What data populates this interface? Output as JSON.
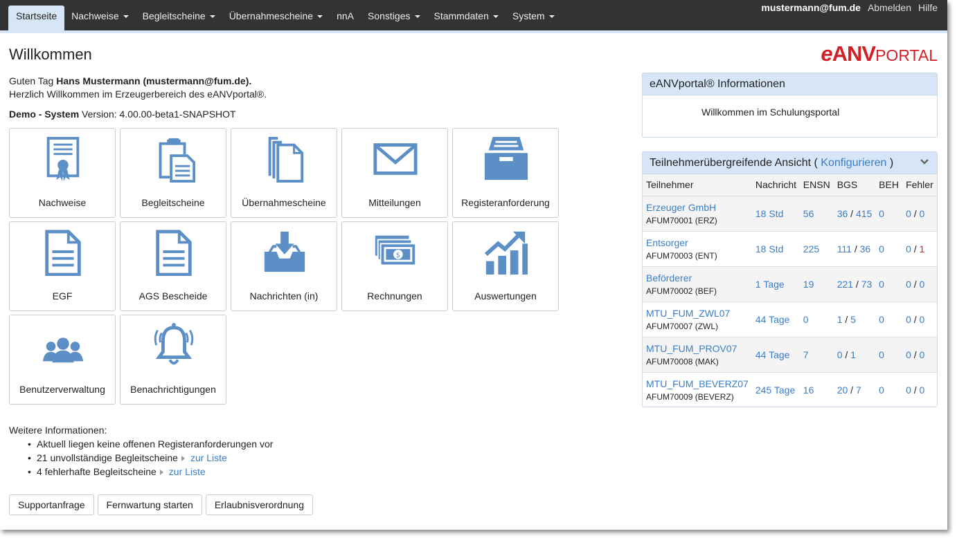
{
  "nav": {
    "items": [
      {
        "label": "Startseite",
        "active": true,
        "dropdown": false
      },
      {
        "label": "Nachweise",
        "active": false,
        "dropdown": true
      },
      {
        "label": "Begleitscheine",
        "active": false,
        "dropdown": true
      },
      {
        "label": "Übernahmescheine",
        "active": false,
        "dropdown": true
      },
      {
        "label": "nnA",
        "active": false,
        "dropdown": false
      },
      {
        "label": "Sonstiges",
        "active": false,
        "dropdown": true
      },
      {
        "label": "Stammdaten",
        "active": false,
        "dropdown": true
      },
      {
        "label": "System",
        "active": false,
        "dropdown": true
      }
    ],
    "user": "mustermann@fum.de",
    "logout": "Abmelden",
    "help": "Hilfe"
  },
  "header": {
    "title": "Willkommen",
    "logo_e": "e",
    "logo_anv": "ANV",
    "logo_portal": "PORTAL"
  },
  "greeting": {
    "prefix": "Guten Tag",
    "name": "Hans Mustermann (mustermann@fum.de).",
    "welcome": "Herzlich Willkommen im Erzeugerbereich des eANVportal®.",
    "system": "Demo - System",
    "version": "Version: 4.00.00-beta1-SNAPSHOT"
  },
  "tiles": [
    {
      "label": "Nachweise",
      "icon": "certificate-icon"
    },
    {
      "label": "Begleitscheine",
      "icon": "clipboard-icon"
    },
    {
      "label": "Übernahmescheine",
      "icon": "documents-stack-icon"
    },
    {
      "label": "Mitteilungen",
      "icon": "envelope-icon"
    },
    {
      "label": "Registeranforderung",
      "icon": "archive-icon"
    },
    {
      "label": "EGF",
      "icon": "document-icon"
    },
    {
      "label": "AGS Bescheide",
      "icon": "document-icon"
    },
    {
      "label": "Nachrichten (in)",
      "icon": "inbox-download-icon"
    },
    {
      "label": "Rechnungen",
      "icon": "money-icon"
    },
    {
      "label": "Auswertungen",
      "icon": "chart-up-icon"
    },
    {
      "label": "Benutzerverwaltung",
      "icon": "users-icon"
    },
    {
      "label": "Benachrichtigungen",
      "icon": "bell-icon"
    }
  ],
  "more_info": {
    "heading": "Weitere Informationen:",
    "items": [
      {
        "text": "Aktuell liegen keine offenen Registeranforderungen vor",
        "link": ""
      },
      {
        "text": "21 unvollständige Begleitscheine",
        "link": "zur Liste"
      },
      {
        "text": "4 fehlerhafte Begleitscheine",
        "link": "zur Liste"
      }
    ]
  },
  "buttons": [
    "Supportanfrage",
    "Fernwartung starten",
    "Erlaubnisverordnung"
  ],
  "info_panel": {
    "title": "eANVportal® Informationen",
    "body": "Willkommen im Schulungsportal"
  },
  "tn_panel": {
    "title": "Teilnehmerübergreifende Ansicht (",
    "config": "Konfigurieren",
    "title_end": ")",
    "columns": [
      "Teilnehmer",
      "Nachricht",
      "ENSN",
      "BGS",
      "BEH",
      "Fehler"
    ],
    "rows": [
      {
        "name": "Erzeuger GmbH",
        "id": "AFUM70001 (ERZ)",
        "nachricht": "18 Std",
        "ensn": "56",
        "bgs_a": "36",
        "bgs_b": "415",
        "beh": "0",
        "f_a": "0",
        "f_b": "0",
        "f_b_red": false
      },
      {
        "name": "Entsorger",
        "id": "AFUM70003 (ENT)",
        "nachricht": "18 Std",
        "ensn": "225",
        "bgs_a": "111",
        "bgs_b": "36",
        "beh": "0",
        "f_a": "0",
        "f_b": "1",
        "f_b_red": true
      },
      {
        "name": "Beförderer",
        "id": "AFUM70002 (BEF)",
        "nachricht": "1 Tage",
        "ensn": "19",
        "bgs_a": "221",
        "bgs_b": "73",
        "beh": "0",
        "f_a": "0",
        "f_b": "0",
        "f_b_red": false
      },
      {
        "name": "MTU_FUM_ZWL07",
        "id": "AFUM70007 (ZWL)",
        "nachricht": "44 Tage",
        "ensn": "0",
        "bgs_a": "1",
        "bgs_b": "5",
        "beh": "0",
        "f_a": "0",
        "f_b": "0",
        "f_b_red": false
      },
      {
        "name": "MTU_FUM_PROV07",
        "id": "AFUM70008 (MAK)",
        "nachricht": "44 Tage",
        "ensn": "7",
        "bgs_a": "0",
        "bgs_b": "1",
        "beh": "0",
        "f_a": "0",
        "f_b": "0",
        "f_b_red": false
      },
      {
        "name": "MTU_FUM_BEVERZ07",
        "id": "AFUM70009 (BEVERZ)",
        "nachricht": "245 Tage",
        "ensn": "16",
        "bgs_a": "20",
        "bgs_b": "7",
        "beh": "0",
        "f_a": "0",
        "f_b": "0",
        "f_b_red": false
      }
    ]
  },
  "colors": {
    "accent": "#3a7dc7",
    "icon": "#5b8fc6",
    "nav": "#333333",
    "active_tab": "#d6e6f7",
    "error": "#d31f26"
  }
}
